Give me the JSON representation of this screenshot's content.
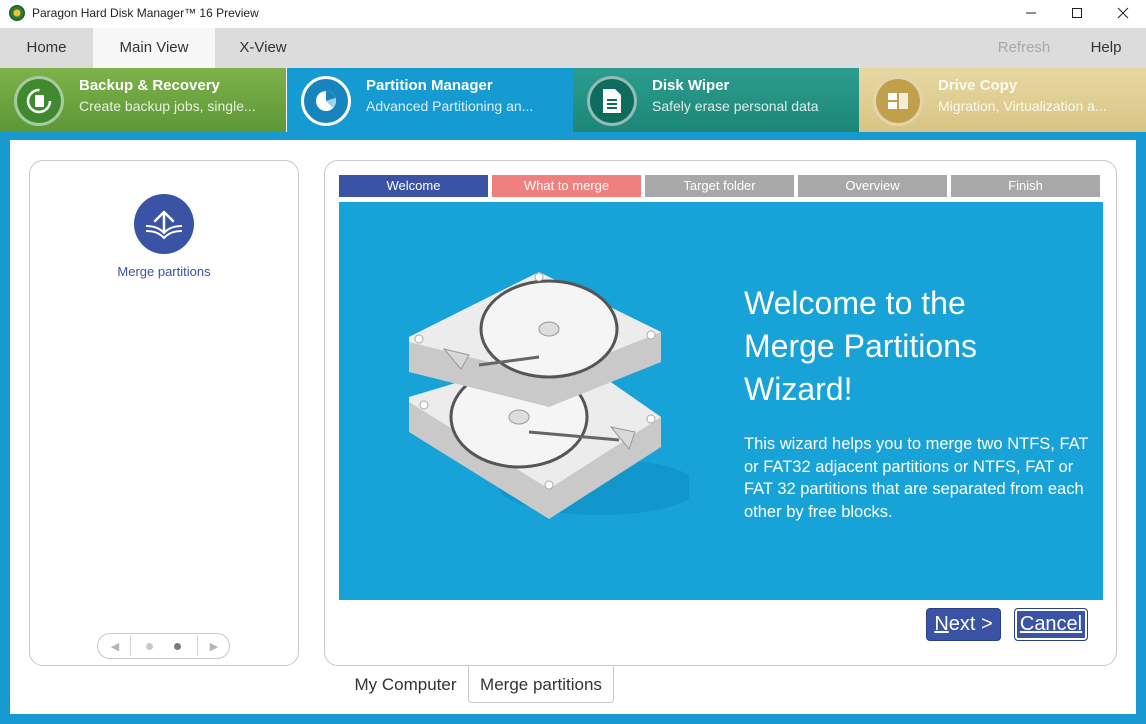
{
  "window": {
    "title": "Paragon Hard Disk Manager™ 16 Preview",
    "controls": {
      "minimize": "—",
      "maximize": "☐",
      "close": "✕"
    }
  },
  "ribbon": {
    "tabs": [
      {
        "label": "Home",
        "active": false
      },
      {
        "label": "Main View",
        "active": true
      },
      {
        "label": "X-View",
        "active": false
      }
    ],
    "refresh_label": "Refresh",
    "help_label": "Help"
  },
  "modules": [
    {
      "name": "Backup & Recovery",
      "desc": "Create backup jobs, single...",
      "icon": "backup-icon",
      "color": "#6aa33e"
    },
    {
      "name": "Partition Manager",
      "desc": "Advanced Partitioning an...",
      "icon": "pie-chart-icon",
      "color": "#159bd2",
      "active": true
    },
    {
      "name": "Disk Wiper",
      "desc": "Safely erase personal data",
      "icon": "document-icon",
      "color": "#23907f"
    },
    {
      "name": "Drive Copy",
      "desc": "Migration, Virtualization a...",
      "icon": "drive-copy-icon",
      "color": "#dccb8c"
    }
  ],
  "left_panel": {
    "operation_label": "Merge partitions",
    "operation_icon": "merge-icon",
    "pager": {
      "prev": "◀",
      "next": "▶",
      "pages": 2,
      "current": 2
    }
  },
  "wizard": {
    "steps": [
      {
        "label": "Welcome",
        "color": "#3a53a4"
      },
      {
        "label": "What to merge",
        "color": "#f08080"
      },
      {
        "label": "Target folder",
        "color": "#a8a8a8"
      },
      {
        "label": "Overview",
        "color": "#a8a8a8"
      },
      {
        "label": "Finish",
        "color": "#a8a8a8"
      }
    ],
    "title_lines": [
      "Welcome to the",
      "Merge Partitions",
      "Wizard!"
    ],
    "description": "This wizard helps you to merge two NTFS, FAT or FAT32 adjacent partitions or NTFS, FAT or FAT 32 partitions that are separated from each other by free blocks.",
    "illustration": "hard-disks-illustration",
    "next_label_underlined": "N",
    "next_label_rest": "ext >",
    "cancel_label_underlined": "C",
    "cancel_label_rest": "ancel"
  },
  "bottom_tabs": [
    {
      "label": "My Computer",
      "active": false
    },
    {
      "label": "Merge partitions",
      "active": true
    }
  ],
  "colors": {
    "accent": "#1899d2",
    "brand_blue": "#3a53a4",
    "hero_bg": "#17a2d8"
  }
}
